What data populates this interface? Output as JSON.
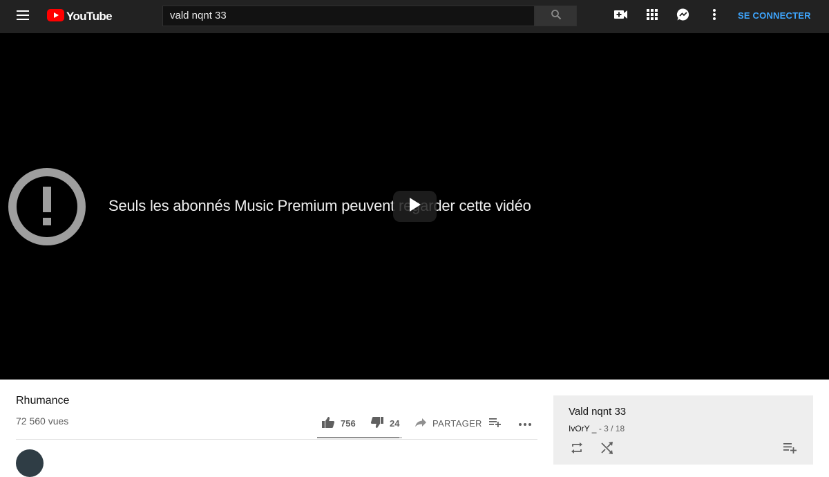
{
  "header": {
    "logo_text": "YouTube",
    "search_value": "vald nqnt 33",
    "signin_label": "SE CONNECTER",
    "icons": [
      "menu-icon",
      "search-icon",
      "video-camera-add-icon",
      "apps-grid-icon",
      "messages-icon",
      "more-vertical-icon"
    ]
  },
  "player": {
    "error_message": "Seuls les abonnés Music Premium peuvent regarder cette vidéo",
    "icons": [
      "error-icon",
      "play-icon"
    ]
  },
  "video": {
    "title": "Rhumance",
    "views": "72 560 vues",
    "likes": "756",
    "dislikes": "24",
    "share_label": "PARTAGER",
    "like_ratio": 0.969
  },
  "playlist": {
    "title": "Vald nqnt 33",
    "owner": "IvOrY _",
    "position": "3 / 18",
    "icons": [
      "loop-icon",
      "shuffle-icon",
      "playlist-add-icon"
    ]
  },
  "colors": {
    "topbar": "#222222",
    "player": "#000000",
    "brand_red": "#ff0000",
    "link_blue": "#3ea6ff",
    "panel_bg": "#eeeeee"
  }
}
